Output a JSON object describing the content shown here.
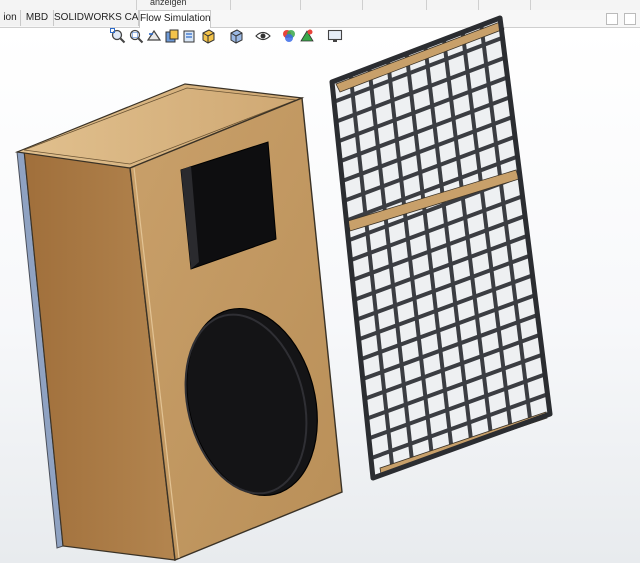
{
  "top_strip": {
    "visible_fragment": "anzeigen"
  },
  "tabs": [
    {
      "label": "ion",
      "active": false
    },
    {
      "label": "MBD",
      "active": false
    },
    {
      "label": "SOLIDWORKS CAM",
      "active": false
    },
    {
      "label": "Flow Simulation",
      "active": true
    }
  ],
  "heads_up_toolbar": {
    "icons": [
      "zoom-to-fit-icon",
      "zoom-to-area-icon",
      "previous-view-icon",
      "section-view-icon",
      "dynamic-annotation-icon",
      "view-orientation-icon",
      "display-style-icon",
      "hide-show-items-icon",
      "edit-appearance-icon",
      "apply-scene-icon",
      "view-settings-icon"
    ]
  },
  "colors": {
    "wood_front": "#c49a62",
    "wood_side": "#a57a45",
    "wood_top": "#d8b683",
    "grille_frame": "#3b3d42",
    "driver": "#141416",
    "accent_blue": "#2e6bc9"
  }
}
